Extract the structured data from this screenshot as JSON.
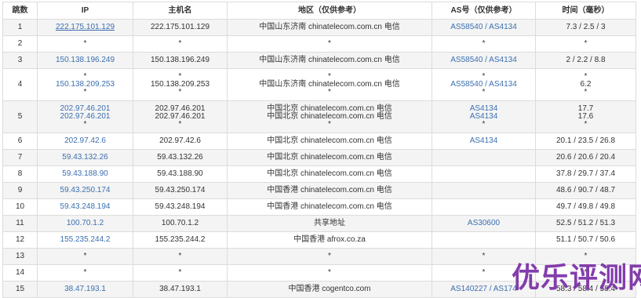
{
  "headers": [
    "跳数",
    "IP",
    "主机名",
    "地区（仅供参考）",
    "AS号（仅供参考）",
    "时间（毫秒）"
  ],
  "rows": [
    {
      "hop": "1",
      "ip": [
        "222.175.101.129"
      ],
      "host": [
        "222.175.101.129"
      ],
      "region": [
        "中国山东济南 chinatelecom.com.cn 电信"
      ],
      "as": [
        "AS58540 / AS4134"
      ],
      "time": [
        "7.3 / 2.5 / 3"
      ]
    },
    {
      "hop": "2",
      "ip": [
        "*"
      ],
      "host": [
        "*"
      ],
      "region": [
        "*"
      ],
      "as": [
        "*"
      ],
      "time": [
        "*"
      ]
    },
    {
      "hop": "3",
      "ip": [
        "150.138.196.249"
      ],
      "host": [
        "150.138.196.249"
      ],
      "region": [
        "中国山东济南 chinatelecom.com.cn 电信"
      ],
      "as": [
        "AS58540 / AS4134"
      ],
      "time": [
        "2 / 2.2 / 8.8"
      ]
    },
    {
      "hop": "4",
      "ip": [
        "*",
        "150.138.209.253",
        "*"
      ],
      "host": [
        "*",
        "150.138.209.253",
        "*"
      ],
      "region": [
        "*",
        "中国山东济南 chinatelecom.com.cn 电信",
        "*"
      ],
      "as": [
        "*",
        "AS58540 / AS4134",
        "*"
      ],
      "time": [
        "*",
        "6.2",
        "*"
      ]
    },
    {
      "hop": "5",
      "ip": [
        "202.97.46.201",
        "202.97.46.201",
        "*"
      ],
      "host": [
        "202.97.46.201",
        "202.97.46.201",
        "*"
      ],
      "region": [
        "中国北京 chinatelecom.com.cn 电信",
        "中国北京 chinatelecom.com.cn 电信",
        "*"
      ],
      "as": [
        "AS4134",
        "AS4134",
        "*"
      ],
      "time": [
        "17.7",
        "17.6",
        "*"
      ]
    },
    {
      "hop": "6",
      "ip": [
        "202.97.42.6"
      ],
      "host": [
        "202.97.42.6"
      ],
      "region": [
        "中国北京 chinatelecom.com.cn 电信"
      ],
      "as": [
        "AS4134"
      ],
      "time": [
        "20.1 / 23.5 / 26.8"
      ]
    },
    {
      "hop": "7",
      "ip": [
        "59.43.132.26"
      ],
      "host": [
        "59.43.132.26"
      ],
      "region": [
        "中国北京 chinatelecom.com.cn 电信"
      ],
      "as": [
        ""
      ],
      "time": [
        "20.6 / 20.6 / 20.4"
      ]
    },
    {
      "hop": "8",
      "ip": [
        "59.43.188.90"
      ],
      "host": [
        "59.43.188.90"
      ],
      "region": [
        "中国北京 chinatelecom.com.cn 电信"
      ],
      "as": [
        ""
      ],
      "time": [
        "37.8 / 29.7 / 37.4"
      ]
    },
    {
      "hop": "9",
      "ip": [
        "59.43.250.174"
      ],
      "host": [
        "59.43.250.174"
      ],
      "region": [
        "中国香港 chinatelecom.com.cn 电信"
      ],
      "as": [
        ""
      ],
      "time": [
        "48.6 / 90.7 / 48.7"
      ]
    },
    {
      "hop": "10",
      "ip": [
        "59.43.248.194"
      ],
      "host": [
        "59.43.248.194"
      ],
      "region": [
        "中国香港 chinatelecom.com.cn 电信"
      ],
      "as": [
        ""
      ],
      "time": [
        "49.7 / 49.8 / 49.8"
      ]
    },
    {
      "hop": "11",
      "ip": [
        "100.70.1.2"
      ],
      "host": [
        "100.70.1.2"
      ],
      "region": [
        "共享地址"
      ],
      "as": [
        "AS30600"
      ],
      "time": [
        "52.5 / 51.2 / 51.3"
      ]
    },
    {
      "hop": "12",
      "ip": [
        "155.235.244.2"
      ],
      "host": [
        "155.235.244.2"
      ],
      "region": [
        "中国香港 afrox.co.za"
      ],
      "as": [
        ""
      ],
      "time": [
        "51.1 / 50.7 / 50.6"
      ]
    },
    {
      "hop": "13",
      "ip": [
        "*"
      ],
      "host": [
        "*"
      ],
      "region": [
        "*"
      ],
      "as": [
        "*"
      ],
      "time": [
        "*"
      ]
    },
    {
      "hop": "14",
      "ip": [
        "*"
      ],
      "host": [
        "*"
      ],
      "region": [
        "*"
      ],
      "as": [
        "*"
      ],
      "time": [
        "*"
      ]
    },
    {
      "hop": "15",
      "ip": [
        "38.47.193.1"
      ],
      "host": [
        "38.47.193.1"
      ],
      "region": [
        "中国香港 cogentco.com"
      ],
      "as": [
        "AS140227 / AS174"
      ],
      "time": [
        "58.3 / 58.4 / 58.4"
      ]
    }
  ],
  "watermark": "优乐评测网",
  "colors": {
    "link": "#3b6fb0",
    "text": "#333333",
    "border": "#dcdcdc",
    "stripe": "#f4f4f4",
    "watermark": "#7b2fa6"
  }
}
